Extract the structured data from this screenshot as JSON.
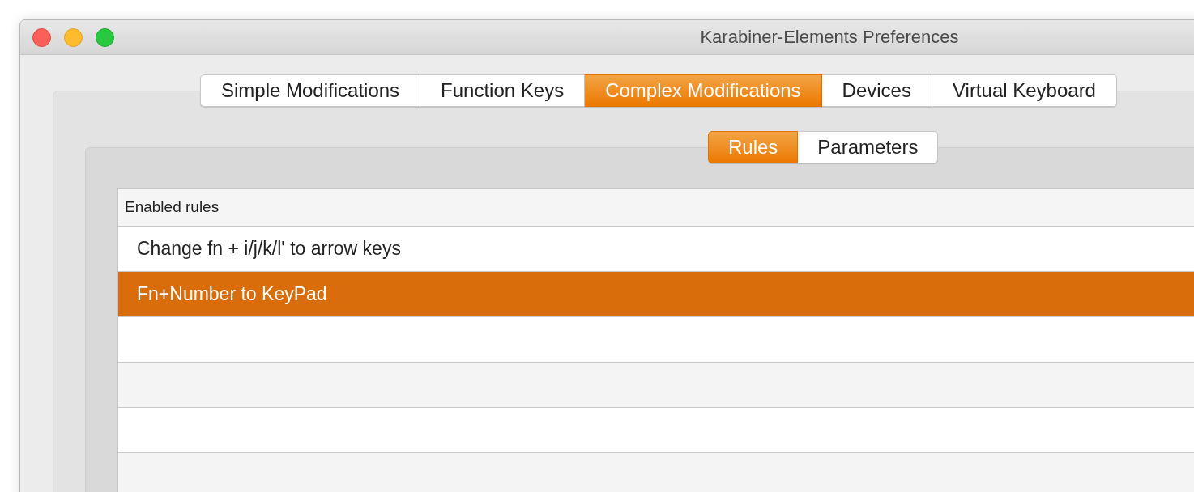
{
  "window": {
    "title": "Karabiner-Elements Preferences"
  },
  "tabs": [
    {
      "label": "Simple Modifications",
      "selected": false
    },
    {
      "label": "Function Keys",
      "selected": false
    },
    {
      "label": "Complex Modifications",
      "selected": true
    },
    {
      "label": "Devices",
      "selected": false
    },
    {
      "label": "Virtual Keyboard",
      "selected": false
    }
  ],
  "subtabs": [
    {
      "label": "Rules",
      "selected": true
    },
    {
      "label": "Parameters",
      "selected": false
    }
  ],
  "table": {
    "columns": [
      "Enabled rules"
    ],
    "rows": [
      {
        "label": "Change fn + i/j/k/l' to arrow keys",
        "selected": false
      },
      {
        "label": "Fn+Number to KeyPad",
        "selected": true
      }
    ]
  }
}
